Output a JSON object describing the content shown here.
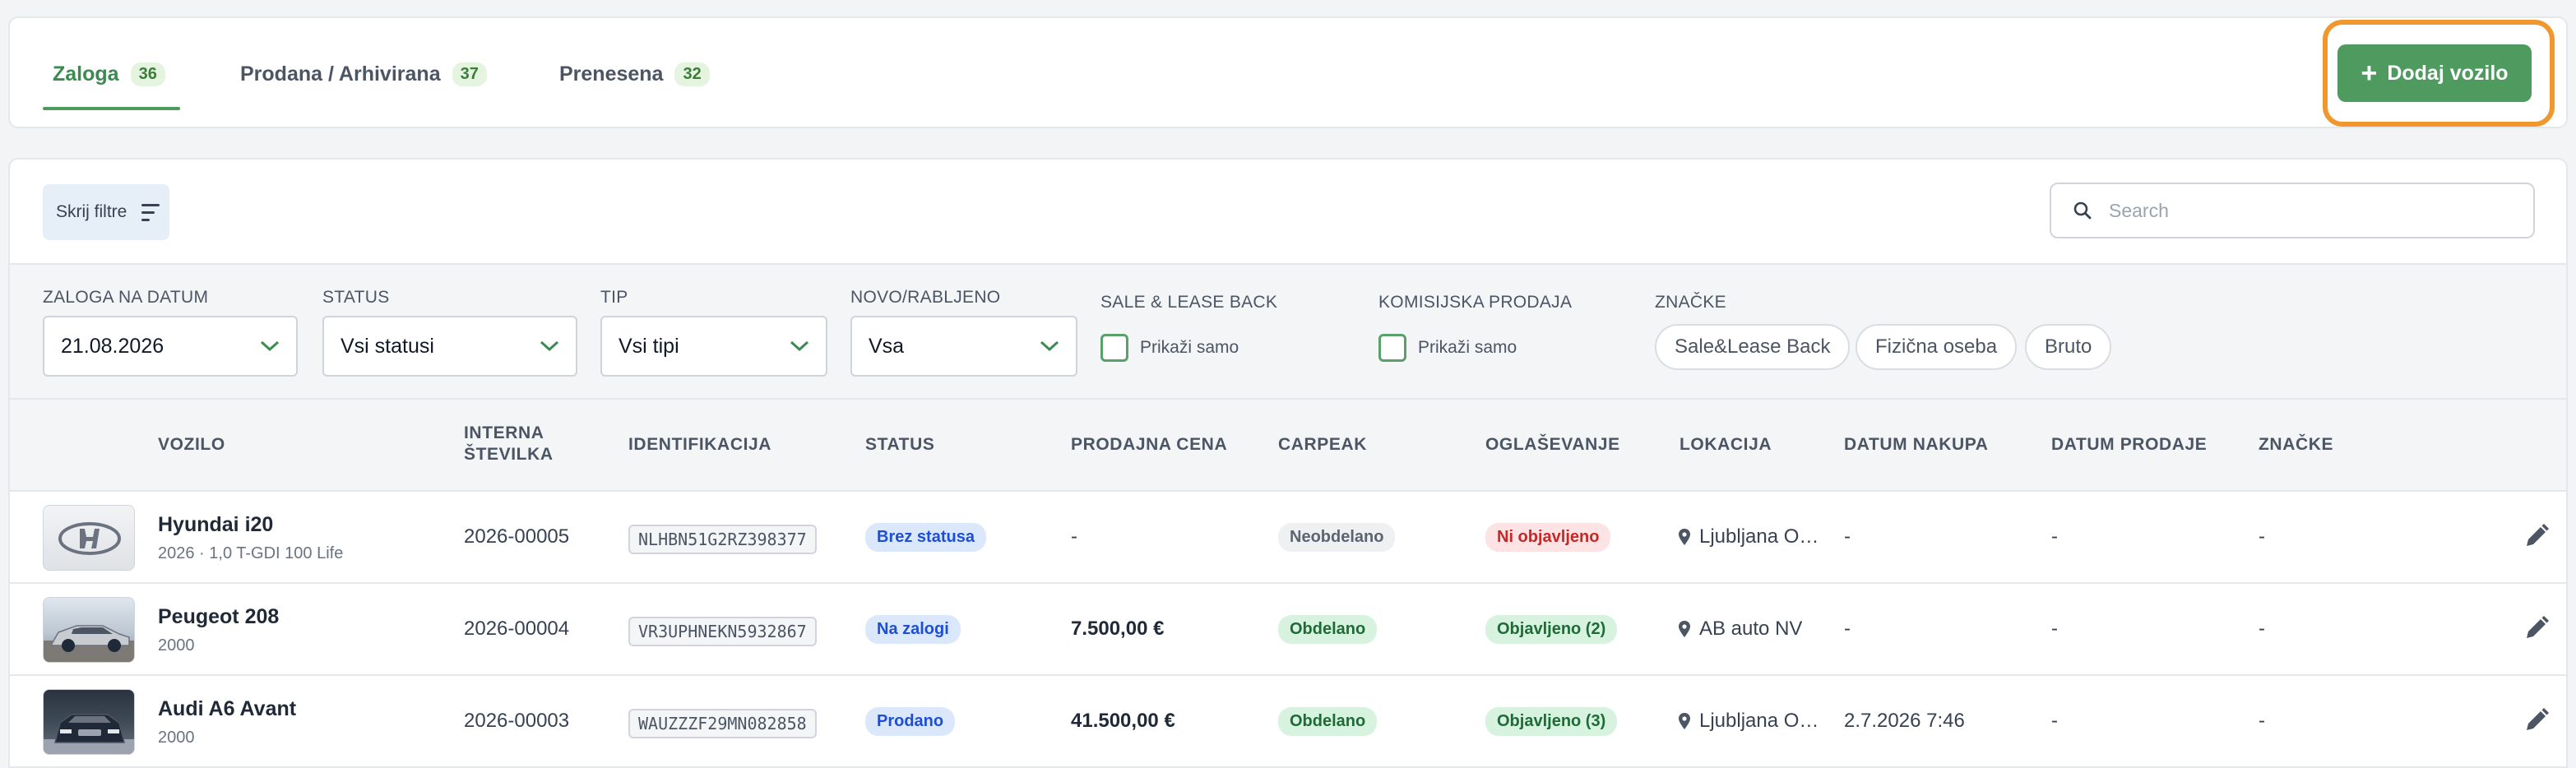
{
  "tabs": [
    {
      "label": "Zaloga",
      "count": "36"
    },
    {
      "label": "Prodana / Arhivirana",
      "count": "37"
    },
    {
      "label": "Prenesena",
      "count": "32"
    }
  ],
  "add_button": {
    "label": "Dodaj vozilo",
    "icon": "plus-icon"
  },
  "toolbar": {
    "filter_toggle_label": "Skrij filtre",
    "search_placeholder": "Search"
  },
  "filters": {
    "date": {
      "label": "ZALOGA NA DATUM",
      "value": "21.08.2026"
    },
    "status": {
      "label": "STATUS",
      "value": "Vsi statusi"
    },
    "type": {
      "label": "TIP",
      "value": "Vsi tipi"
    },
    "condition": {
      "label": "NOVO/RABLJENO",
      "value": "Vsa"
    },
    "sale_lease": {
      "label": "SALE & LEASE BACK",
      "checkbox_label": "Prikaži samo"
    },
    "commission": {
      "label": "KOMISIJSKA PRODAJA",
      "checkbox_label": "Prikaži samo"
    },
    "tags": {
      "label": "ZNAČKE",
      "options": [
        "Sale&Lease Back",
        "Fizična oseba",
        "Bruto"
      ]
    }
  },
  "table": {
    "headers": {
      "vehicle": "VOZILO",
      "internal_line1": "INTERNA",
      "internal_line2": "ŠTEVILKA",
      "identification": "IDENTIFIKACIJA",
      "status": "STATUS",
      "price": "PRODAJNA CENA",
      "carpeak": "CARPEAK",
      "advertising": "OGLAŠEVANJE",
      "location": "LOKACIJA",
      "purchase_date": "DATUM NAKUPA",
      "sale_date": "DATUM PRODAJE",
      "tags": "ZNAČKE"
    },
    "rows": [
      {
        "name": "Hyundai i20",
        "subtitle": "2026 · 1,0 T-GDI 100 Life",
        "internal": "2026-00005",
        "vin": "NLHBN51G2RZ398377",
        "status": "Brez statusa",
        "price": "-",
        "carpeak": "Neobdelano",
        "advertising": "Ni objavljeno",
        "location": "Ljubljana O…",
        "purchase_date": "-",
        "sale_date": "-",
        "tags": "-"
      },
      {
        "name": "Peugeot 208",
        "subtitle": "2000",
        "internal": "2026-00004",
        "vin": "VR3UPHNEKN5932867",
        "status": "Na zalogi",
        "price": "7.500,00 €",
        "carpeak": "Obdelano",
        "advertising": "Objavljeno (2)",
        "location": "AB auto NV",
        "purchase_date": "-",
        "sale_date": "-",
        "tags": "-"
      },
      {
        "name": "Audi A6 Avant",
        "subtitle": "2000",
        "internal": "2026-00003",
        "vin": "WAUZZZF29MN082858",
        "status": "Prodano",
        "price": "41.500,00 €",
        "carpeak": "Obdelano",
        "advertising": "Objavljeno (3)",
        "location": "Ljubljana O…",
        "purchase_date": "2.7.2026 7:46",
        "sale_date": "-",
        "tags": "-"
      }
    ]
  },
  "colors": {
    "primary": "#4f9a5f",
    "highlight": "#f0972f",
    "tab_badge_bg": "#e4f4df"
  }
}
